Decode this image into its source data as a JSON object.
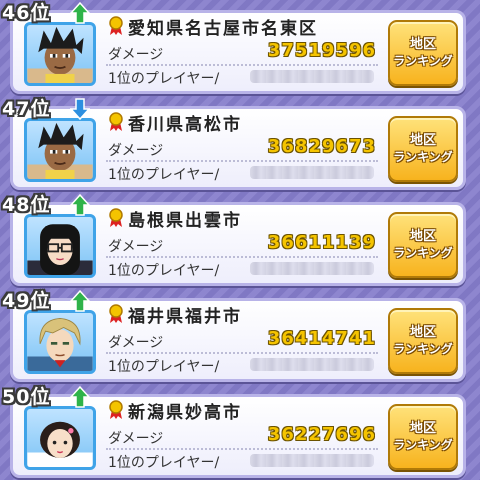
{
  "colors": {
    "value_gold": "#f5c400",
    "up_arrow": "#2fb34a",
    "down_arrow": "#2d8fe0",
    "button_gold": "#f7b31e",
    "avatar_border": "#3fa3e8"
  },
  "labels": {
    "damage": "ダメージ",
    "top_player": "1位のプレイヤー/",
    "button_line1": "地区",
    "button_line2": "ランキング"
  },
  "rows": [
    {
      "rank": "46位",
      "trend": "up",
      "region": "愛知県名古屋市名東区",
      "damage": "37519596",
      "avatar": "spiky-black-hair-boy"
    },
    {
      "rank": "47位",
      "trend": "down",
      "region": "香川県高松市",
      "damage": "36829673",
      "avatar": "spiky-black-hair-boy"
    },
    {
      "rank": "48位",
      "trend": "up",
      "region": "島根県出雲市",
      "damage": "36611139",
      "avatar": "glasses-girl"
    },
    {
      "rank": "49位",
      "trend": "up",
      "region": "福井県福井市",
      "damage": "36414741",
      "avatar": "blonde-hair-boy"
    },
    {
      "rank": "50位",
      "trend": "up",
      "region": "新潟県妙高市",
      "damage": "36227696",
      "avatar": "dark-hair-girl"
    }
  ]
}
